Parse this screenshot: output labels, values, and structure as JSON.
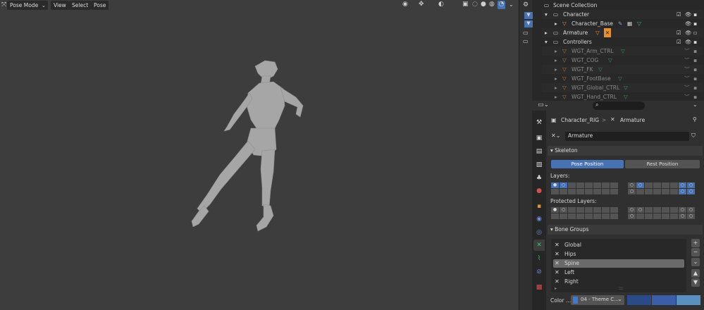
{
  "viewport": {
    "mode_label": "Pose Mode",
    "menus": [
      "View",
      "Select",
      "Pose"
    ]
  },
  "outliner": {
    "scene_collection": "Scene Collection",
    "rows": [
      {
        "label": "Character"
      },
      {
        "label": "Character_Base"
      },
      {
        "label": "Armature"
      },
      {
        "label": "Controllers"
      },
      {
        "label": "WGT_Arm_CTRL"
      },
      {
        "label": "WGT_COG"
      },
      {
        "label": "WGT_FK"
      },
      {
        "label": "WGT_FootBase"
      },
      {
        "label": "WGT_Global_CTRL"
      },
      {
        "label": "WGT_Hand_CTRL"
      }
    ]
  },
  "properties": {
    "breadcrumb_object": "Character_RIG",
    "breadcrumb_data": "Armature",
    "datablock_name": "Armature",
    "skeleton": {
      "title": "Skeleton",
      "pose_position": "Pose Position",
      "rest_position": "Rest Position",
      "layers_label": "Layers:",
      "protected_label": "Protected Layers:"
    },
    "bone_groups": {
      "title": "Bone Groups",
      "items": [
        "Global",
        "Hips",
        "Spine",
        "Left",
        "Right"
      ],
      "selected": "Spine",
      "color_label": "Color ...",
      "color_value": "04 - Theme C..."
    }
  },
  "colors": {
    "accent": "#4772b3",
    "viewport_bg": "#3d3d3d",
    "panel_bg": "#303030",
    "mesh_orange": "#e8902e",
    "widget_green": "#3ac26e"
  }
}
